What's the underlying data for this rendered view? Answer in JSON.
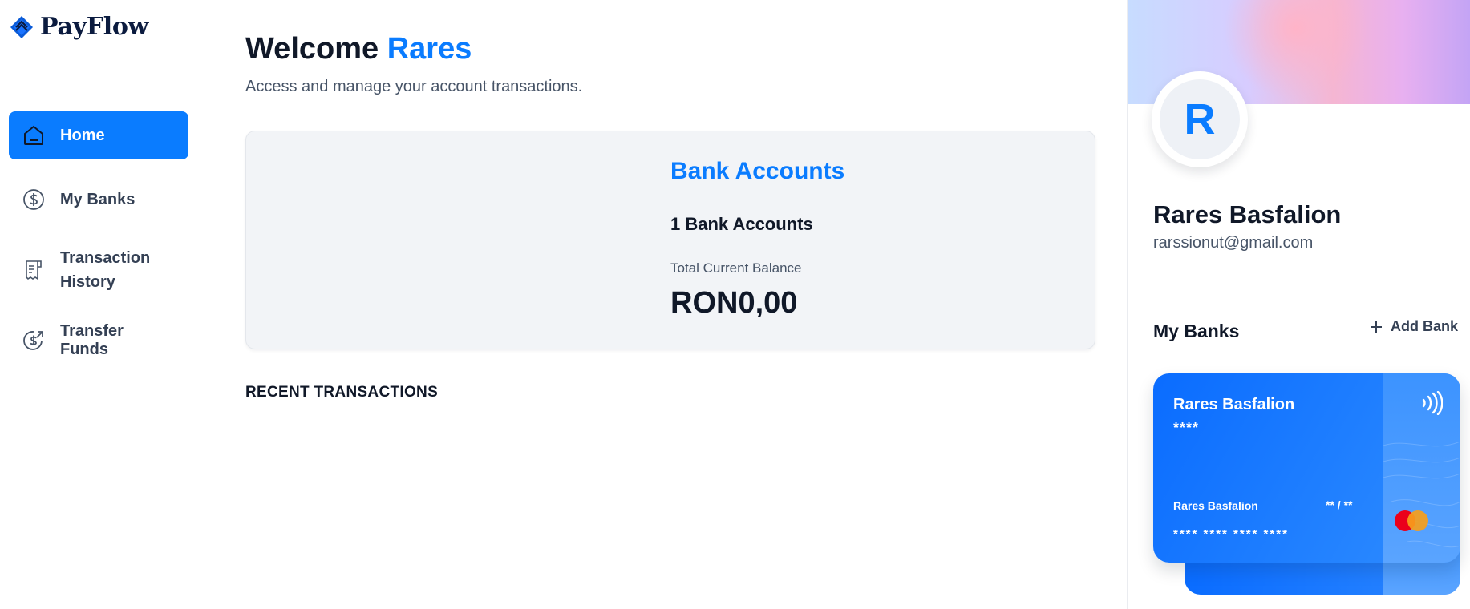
{
  "app": {
    "name": "PayFlow"
  },
  "sidebar": {
    "items": [
      {
        "label": "Home",
        "icon": "home-icon",
        "active": true
      },
      {
        "label": "My Banks",
        "icon": "dollar-circle-icon"
      },
      {
        "label": "Transaction History",
        "icon": "receipt-icon"
      },
      {
        "label": "Transfer Funds",
        "icon": "money-send-icon"
      }
    ]
  },
  "header": {
    "greeting": "Welcome",
    "user_first_name": "Rares",
    "subtitle": "Access and manage your account transactions."
  },
  "balance": {
    "title": "Bank Accounts",
    "count_text": "1 Bank Accounts",
    "label": "Total Current Balance",
    "amount": "RON0,00"
  },
  "recent": {
    "title": "RECENT TRANSACTIONS"
  },
  "profile": {
    "initial": "R",
    "name": "Rares Basfalion",
    "email": "rarssionut@gmail.com"
  },
  "my_banks": {
    "title": "My Banks",
    "add_label": "Add Bank",
    "cards": [
      {
        "holder": "Rares Basfalion",
        "mask": "****",
        "holder_bottom": "Rares Basfalion",
        "expiry": "** / **",
        "number": "**** **** **** ****"
      },
      {
        "number": "**** **** **** ****"
      }
    ]
  },
  "colors": {
    "accent": "#0a7cff",
    "text_primary": "#101828",
    "text_secondary": "#475467",
    "card_bg": "#f2f4f7"
  }
}
